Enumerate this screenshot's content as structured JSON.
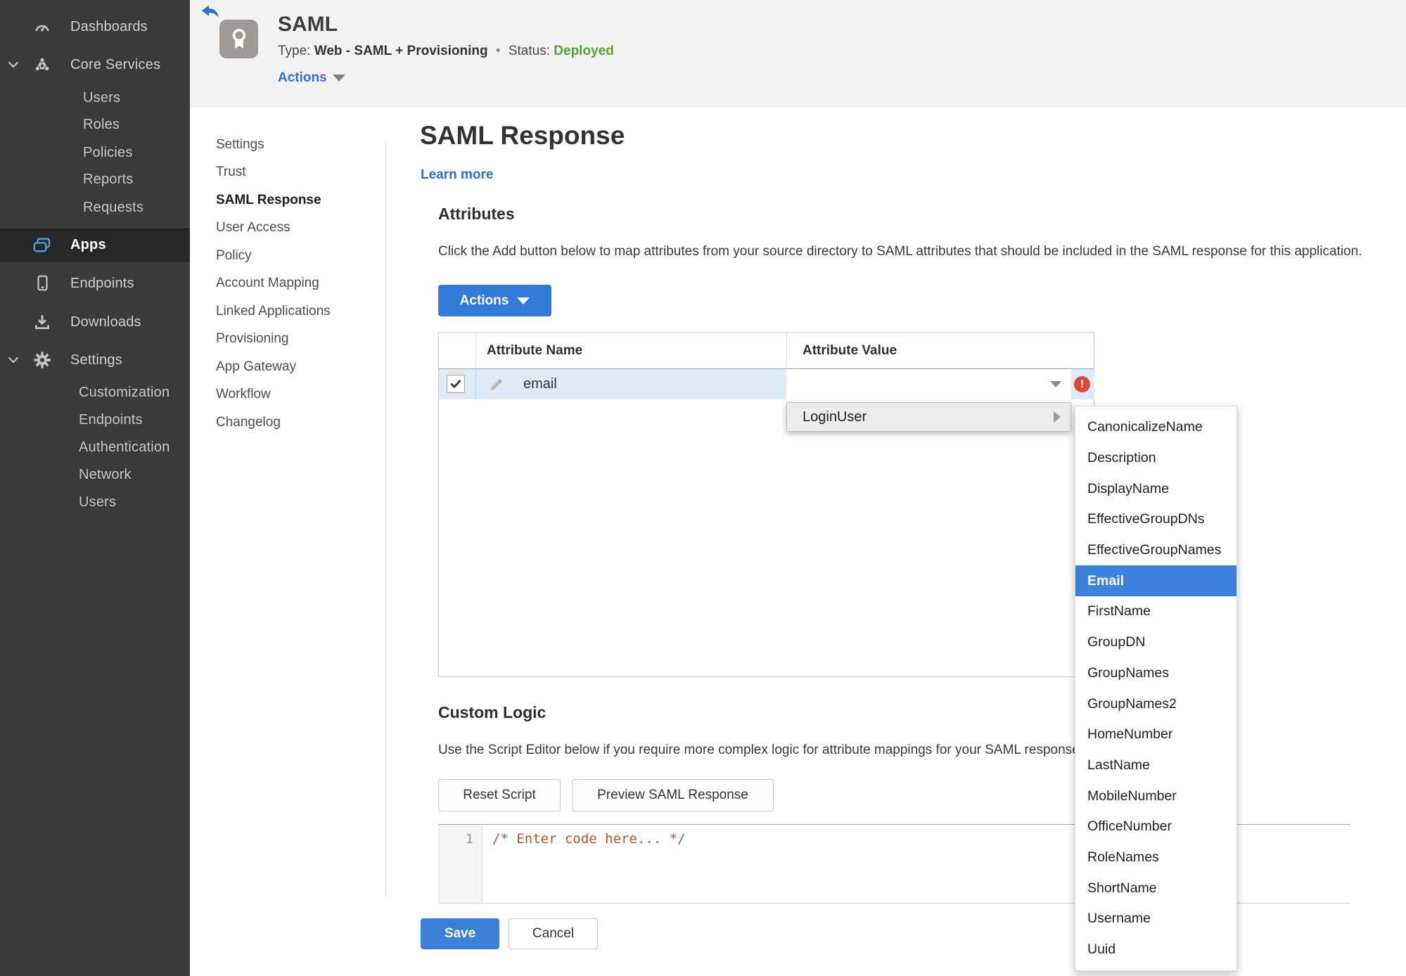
{
  "sidebar": {
    "items": [
      {
        "label": "Dashboards",
        "icon": "gauge-icon"
      },
      {
        "label": "Core Services",
        "icon": "core-services-icon",
        "expanded": true
      },
      {
        "label": "Users"
      },
      {
        "label": "Roles"
      },
      {
        "label": "Policies"
      },
      {
        "label": "Reports"
      },
      {
        "label": "Requests"
      },
      {
        "label": "Apps",
        "icon": "apps-icon",
        "active": true
      },
      {
        "label": "Endpoints",
        "icon": "device-icon"
      },
      {
        "label": "Downloads",
        "icon": "download-icon"
      },
      {
        "label": "Settings",
        "icon": "gear-icon",
        "expanded": true
      },
      {
        "label": "Customization"
      },
      {
        "label": "Endpoints"
      },
      {
        "label": "Authentication"
      },
      {
        "label": "Network"
      },
      {
        "label": "Users"
      }
    ]
  },
  "header": {
    "title": "SAML",
    "type_label": "Type:",
    "type_value": "Web - SAML + Provisioning",
    "separator": "•",
    "status_label": "Status:",
    "status_value": "Deployed",
    "actions_label": "Actions",
    "app_icon": "award-ribbon-icon",
    "back_icon": "back-arrow-icon"
  },
  "subnav": {
    "active": "SAML Response",
    "items": [
      {
        "label": "Settings"
      },
      {
        "label": "Trust"
      },
      {
        "label": "SAML Response"
      },
      {
        "label": "User Access"
      },
      {
        "label": "Policy"
      },
      {
        "label": "Account Mapping"
      },
      {
        "label": "Linked Applications"
      },
      {
        "label": "Provisioning"
      },
      {
        "label": "App Gateway"
      },
      {
        "label": "Workflow"
      },
      {
        "label": "Changelog"
      }
    ]
  },
  "main": {
    "title": "SAML Response",
    "learn_more": "Learn more",
    "attributes": {
      "heading": "Attributes",
      "description": "Click the Add button below to map attributes from your source directory to SAML attributes that should be included in the SAML response for this application.",
      "actions_label": "Actions",
      "table": {
        "columns": [
          "Attribute Name",
          "Attribute Value"
        ],
        "rows": [
          {
            "name": "email",
            "value": "",
            "checked": true,
            "error": true
          }
        ]
      }
    },
    "value_menu": {
      "label": "LoginUser",
      "selected": "Email",
      "options": [
        "CanonicalizeName",
        "Description",
        "DisplayName",
        "EffectiveGroupDNs",
        "EffectiveGroupNames",
        "Email",
        "FirstName",
        "GroupDN",
        "GroupNames",
        "GroupNames2",
        "HomeNumber",
        "LastName",
        "MobileNumber",
        "OfficeNumber",
        "RoleNames",
        "ShortName",
        "Username",
        "Uuid"
      ]
    },
    "custom_logic": {
      "heading": "Custom Logic",
      "description": "Use the Script Editor below if you require more complex logic for attribute mappings for your SAML response.",
      "reset_label": "Reset Script",
      "preview_label": "Preview SAML Response",
      "editor": {
        "line_number": "1",
        "code": "/* Enter code here... */"
      }
    },
    "footer": {
      "save_label": "Save",
      "cancel_label": "Cancel"
    }
  },
  "colors": {
    "accent_blue": "#3b80d8",
    "link_blue": "#2e6fd8",
    "status_green": "#55a532",
    "error_red": "#d84a34",
    "row_highlight": "#dfeaf7",
    "sidebar_bg": "#3a3a3a",
    "header_bg": "#f2f2f2",
    "code_orange": "#b3562d",
    "apps_icon_blue": "#4aa3e8"
  }
}
